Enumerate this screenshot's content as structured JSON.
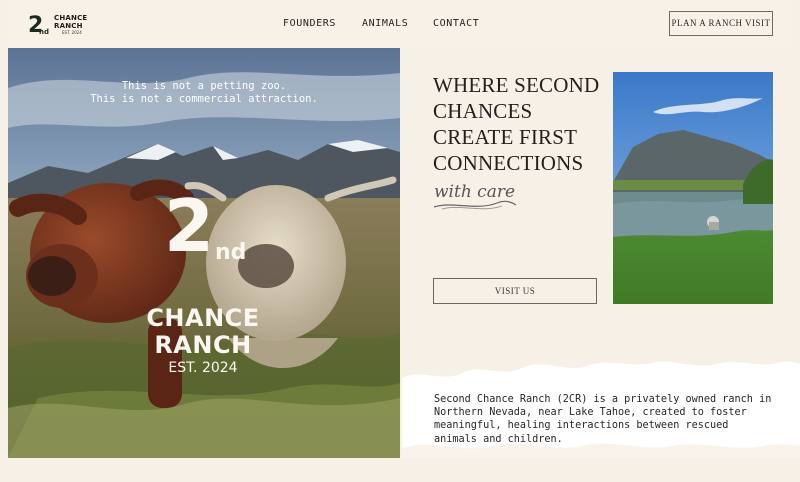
{
  "brand": {
    "logo_lines": [
      "CHANCE",
      "RANCH"
    ],
    "logo_est": "EST. 2024"
  },
  "nav": {
    "items": [
      "FOUNDERS",
      "ANIMALS",
      "CONTACT"
    ],
    "cta": "PLAN A RANCH VISIT"
  },
  "hero": {
    "line1": "This is not a petting zoo.",
    "line2": "This is not a commercial attraction.",
    "logo": {
      "number": "2",
      "suffix": "nd",
      "chance": "CHANCE",
      "ranch": "RANCH",
      "est": "EST. 2024"
    }
  },
  "main": {
    "headline": "WHERE SECOND CHANCES CREATE FIRST CONNECTIONS",
    "script": "with care",
    "visit_button": "VISIT US",
    "description": "Second Chance Ranch (2CR) is a privately owned ranch in Northern Nevada, near Lake Tahoe, created to foster meaningful, healing interactions between rescued animals and children."
  },
  "colors": {
    "background": "#f7f0e7",
    "text": "#231f1c",
    "border": "#6e6a66"
  }
}
